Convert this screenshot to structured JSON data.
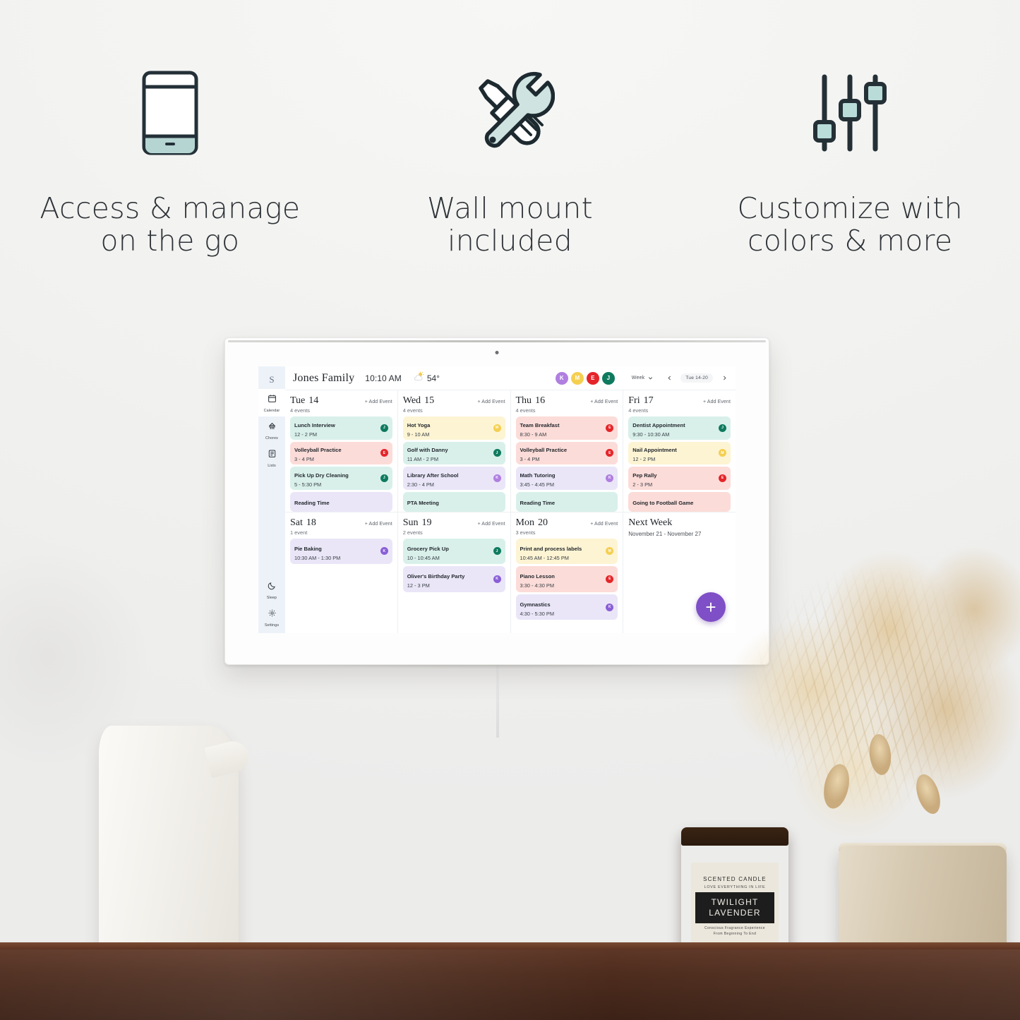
{
  "features": [
    {
      "icon": "phone-icon",
      "label": "Access & manage\non the go"
    },
    {
      "icon": "tools-icon",
      "label": "Wall mount\nincluded"
    },
    {
      "icon": "sliders-icon",
      "label": "Customize with\ncolors & more"
    }
  ],
  "device": {
    "sidebar": {
      "logo": "S",
      "items": [
        {
          "id": "calendar",
          "label": "Calendar",
          "icon": "calendar-icon",
          "active": true
        },
        {
          "id": "chores",
          "label": "Chores",
          "icon": "chores-icon",
          "active": false
        },
        {
          "id": "lists",
          "label": "Lists",
          "icon": "lists-icon",
          "active": false
        }
      ],
      "bottom_items": [
        {
          "id": "sleep",
          "label": "Sleep",
          "icon": "moon-icon",
          "active": false
        },
        {
          "id": "settings",
          "label": "Settings",
          "icon": "gear-icon",
          "active": false
        }
      ]
    },
    "topbar": {
      "family_name": "Jones Family",
      "time": "10:10 AM",
      "weather_icon": "sun-behind-cloud-icon",
      "temperature": "54°",
      "avatars": [
        {
          "initial": "K",
          "color": "#b07fe0"
        },
        {
          "initial": "M",
          "color": "#f5cf52"
        },
        {
          "initial": "E",
          "color": "#e5252a"
        },
        {
          "initial": "J",
          "color": "#0f7a5f"
        }
      ],
      "view_label": "Week",
      "prev_label": "‹",
      "next_label": "›",
      "date_range": "Tue 14-20"
    },
    "add_event_label": "+ Add Event",
    "fab_label": "+",
    "days": [
      {
        "dow": "Tue",
        "num": "14",
        "count": "4 events",
        "events": [
          {
            "title": "Lunch Interview",
            "time": "12 - 2 PM",
            "bg": "#d9f0ea",
            "dot": "#0f7a5f",
            "initial": "J"
          },
          {
            "title": "Volleyball Practice",
            "time": "3 - 4 PM",
            "bg": "#fcdcd8",
            "dot": "#e5252a",
            "initial": "E"
          },
          {
            "title": "Pick Up Dry Cleaning",
            "time": "5 - 5:30 PM",
            "bg": "#d9f0ea",
            "dot": "#0f7a5f",
            "initial": "J"
          },
          {
            "title": "Reading Time",
            "time": "",
            "bg": "#eae6f8",
            "dot": "#b07fe0",
            "initial": "K"
          }
        ]
      },
      {
        "dow": "Wed",
        "num": "15",
        "count": "4 events",
        "events": [
          {
            "title": "Hot Yoga",
            "time": "9 - 10 AM",
            "bg": "#fdf4d3",
            "dot": "#f5cf52",
            "initial": "M"
          },
          {
            "title": "Golf with Danny",
            "time": "11 AM - 2 PM",
            "bg": "#d9f0ea",
            "dot": "#0f7a5f",
            "initial": "J"
          },
          {
            "title": "Library After School",
            "time": "2:30 - 4 PM",
            "bg": "#eae6f8",
            "dot": "#b07fe0",
            "initial": "K"
          },
          {
            "title": "PTA Meeting",
            "time": "",
            "bg": "#d9f0ea",
            "dot": "#0f7a5f",
            "initial": "J"
          }
        ]
      },
      {
        "dow": "Thu",
        "num": "16",
        "count": "4 events",
        "events": [
          {
            "title": "Team Breakfast",
            "time": "8:30 - 9 AM",
            "bg": "#fcdcd8",
            "dot": "#e5252a",
            "initial": "E"
          },
          {
            "title": "Volleyball Practice",
            "time": "3 - 4 PM",
            "bg": "#fcdcd8",
            "dot": "#e5252a",
            "initial": "E"
          },
          {
            "title": "Math Tutoring",
            "time": "3:45 - 4:45 PM",
            "bg": "#eae6f8",
            "dot": "#b07fe0",
            "initial": "K"
          },
          {
            "title": "Reading Time",
            "time": "",
            "bg": "#d9f0ea",
            "dot": "#0f7a5f",
            "initial": "J"
          }
        ]
      },
      {
        "dow": "Fri",
        "num": "17",
        "count": "4 events",
        "events": [
          {
            "title": "Dentist Appointment",
            "time": "9:30 - 10:30 AM",
            "bg": "#d9f0ea",
            "dot": "#0f7a5f",
            "initial": "J"
          },
          {
            "title": "Nail Appointment",
            "time": "12 - 2 PM",
            "bg": "#fdf4d3",
            "dot": "#f5cf52",
            "initial": "M"
          },
          {
            "title": "Pep Rally",
            "time": "2 - 3 PM",
            "bg": "#fcdcd8",
            "dot": "#e5252a",
            "initial": "E"
          },
          {
            "title": "Going to Football Game",
            "time": "",
            "bg": "#fcdcd8",
            "dot": "#e5252a",
            "initial": "E"
          }
        ]
      },
      {
        "dow": "Sat",
        "num": "18",
        "count": "1 event",
        "events": [
          {
            "title": "Pie Baking",
            "time": "10:30 AM - 1:30 PM",
            "bg": "#eae6f8",
            "dot": "#8a5fd6",
            "initial": "K"
          }
        ]
      },
      {
        "dow": "Sun",
        "num": "19",
        "count": "2 events",
        "events": [
          {
            "title": "Grocery Pick Up",
            "time": "10 - 10:45 AM",
            "bg": "#d9f0ea",
            "dot": "#0f7a5f",
            "initial": "J"
          },
          {
            "title": "Oliver's Birthday Party",
            "time": "12 - 3 PM",
            "bg": "#eae6f8",
            "dot": "#8a5fd6",
            "initial": "K"
          }
        ]
      },
      {
        "dow": "Mon",
        "num": "20",
        "count": "3 events",
        "events": [
          {
            "title": "Print and process labels",
            "time": "10:45 AM - 12:45 PM",
            "bg": "#fdf4d3",
            "dot": "#f5cf52",
            "initial": "M"
          },
          {
            "title": "Piano Lesson",
            "time": "3:30 - 4:30 PM",
            "bg": "#fcdcd8",
            "dot": "#e5252a",
            "initial": "E"
          },
          {
            "title": "Gymnastics",
            "time": "4:30 - 5:30 PM",
            "bg": "#eae6f8",
            "dot": "#8a5fd6",
            "initial": "K"
          }
        ]
      }
    ],
    "next_week": {
      "title": "Next Week",
      "range": "November 21 - November 27"
    }
  },
  "candle": {
    "top": "SCENTED CANDLE",
    "sub": "LOVE EVERYTHING IN LIFE",
    "name": "TWILIGHT\nLAVENDER",
    "foot": "Conscious Fragrance Experience\nFrom Beginning To End"
  }
}
